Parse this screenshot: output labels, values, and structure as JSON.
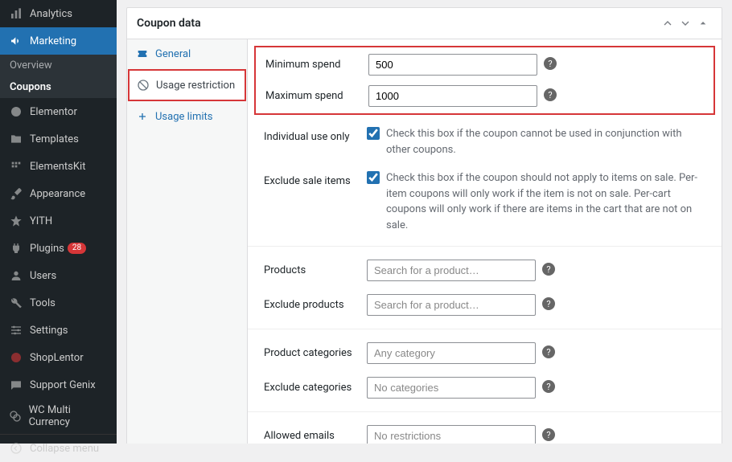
{
  "sidebar": {
    "items": [
      {
        "label": "Analytics"
      },
      {
        "label": "Marketing"
      },
      {
        "label": "Elementor"
      },
      {
        "label": "Templates"
      },
      {
        "label": "ElementsKit"
      },
      {
        "label": "Appearance"
      },
      {
        "label": "YITH"
      },
      {
        "label": "Plugins",
        "badge": "28"
      },
      {
        "label": "Users"
      },
      {
        "label": "Tools"
      },
      {
        "label": "Settings"
      },
      {
        "label": "ShopLentor"
      },
      {
        "label": "Support Genix"
      },
      {
        "label": "WC Multi Currency"
      }
    ],
    "submenu": {
      "overview": "Overview",
      "coupons": "Coupons"
    },
    "collapse": "Collapse menu"
  },
  "panel": {
    "title": "Coupon data",
    "tabs": {
      "general": "General",
      "usage_restriction": "Usage restriction",
      "usage_limits": "Usage limits"
    },
    "fields": {
      "min_spend": {
        "label": "Minimum spend",
        "value": "500"
      },
      "max_spend": {
        "label": "Maximum spend",
        "value": "1000"
      },
      "individual": {
        "label": "Individual use only",
        "desc": "Check this box if the coupon cannot be used in conjunction with other coupons."
      },
      "exclude_sale": {
        "label": "Exclude sale items",
        "desc": "Check this box if the coupon should not apply to items on sale. Per-item coupons will only work if the item is not on sale. Per-cart coupons will only work if there are items in the cart that are not on sale."
      },
      "products": {
        "label": "Products",
        "placeholder": "Search for a product…"
      },
      "exclude_products": {
        "label": "Exclude products",
        "placeholder": "Search for a product…"
      },
      "product_categories": {
        "label": "Product categories",
        "placeholder": "Any category"
      },
      "exclude_categories": {
        "label": "Exclude categories",
        "placeholder": "No categories"
      },
      "allowed_emails": {
        "label": "Allowed emails",
        "placeholder": "No restrictions"
      }
    }
  }
}
